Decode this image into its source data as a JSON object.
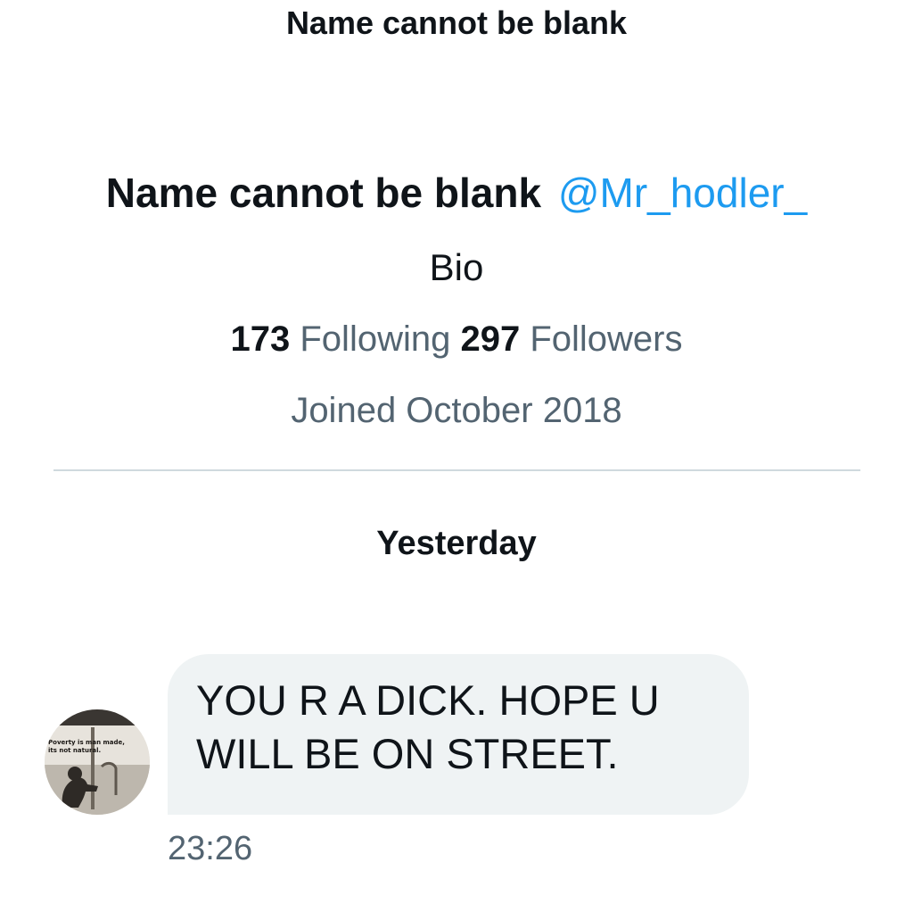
{
  "header": {
    "title": "Name cannot be blank"
  },
  "profile": {
    "name": "Name cannot be blank",
    "handle": "@Mr_hodler_",
    "bio": "Bio",
    "following_count": "173",
    "following_label": "Following",
    "followers_count": "297",
    "followers_label": "Followers",
    "joined": "Joined October 2018"
  },
  "conversation": {
    "date_separator": "Yesterday",
    "messages": [
      {
        "line1": "YOU R A DICK. HOPE U",
        "line2": "WILL BE ON STREET.",
        "time": "23:26",
        "avatar_caption_line1": "Poverty is man made,",
        "avatar_caption_line2": "its not natural."
      }
    ]
  },
  "colors": {
    "text_primary": "#0f1419",
    "text_secondary": "#536471",
    "accent": "#1d9bf0",
    "bubble_bg": "#eff3f4",
    "divider": "#cfd9de"
  }
}
